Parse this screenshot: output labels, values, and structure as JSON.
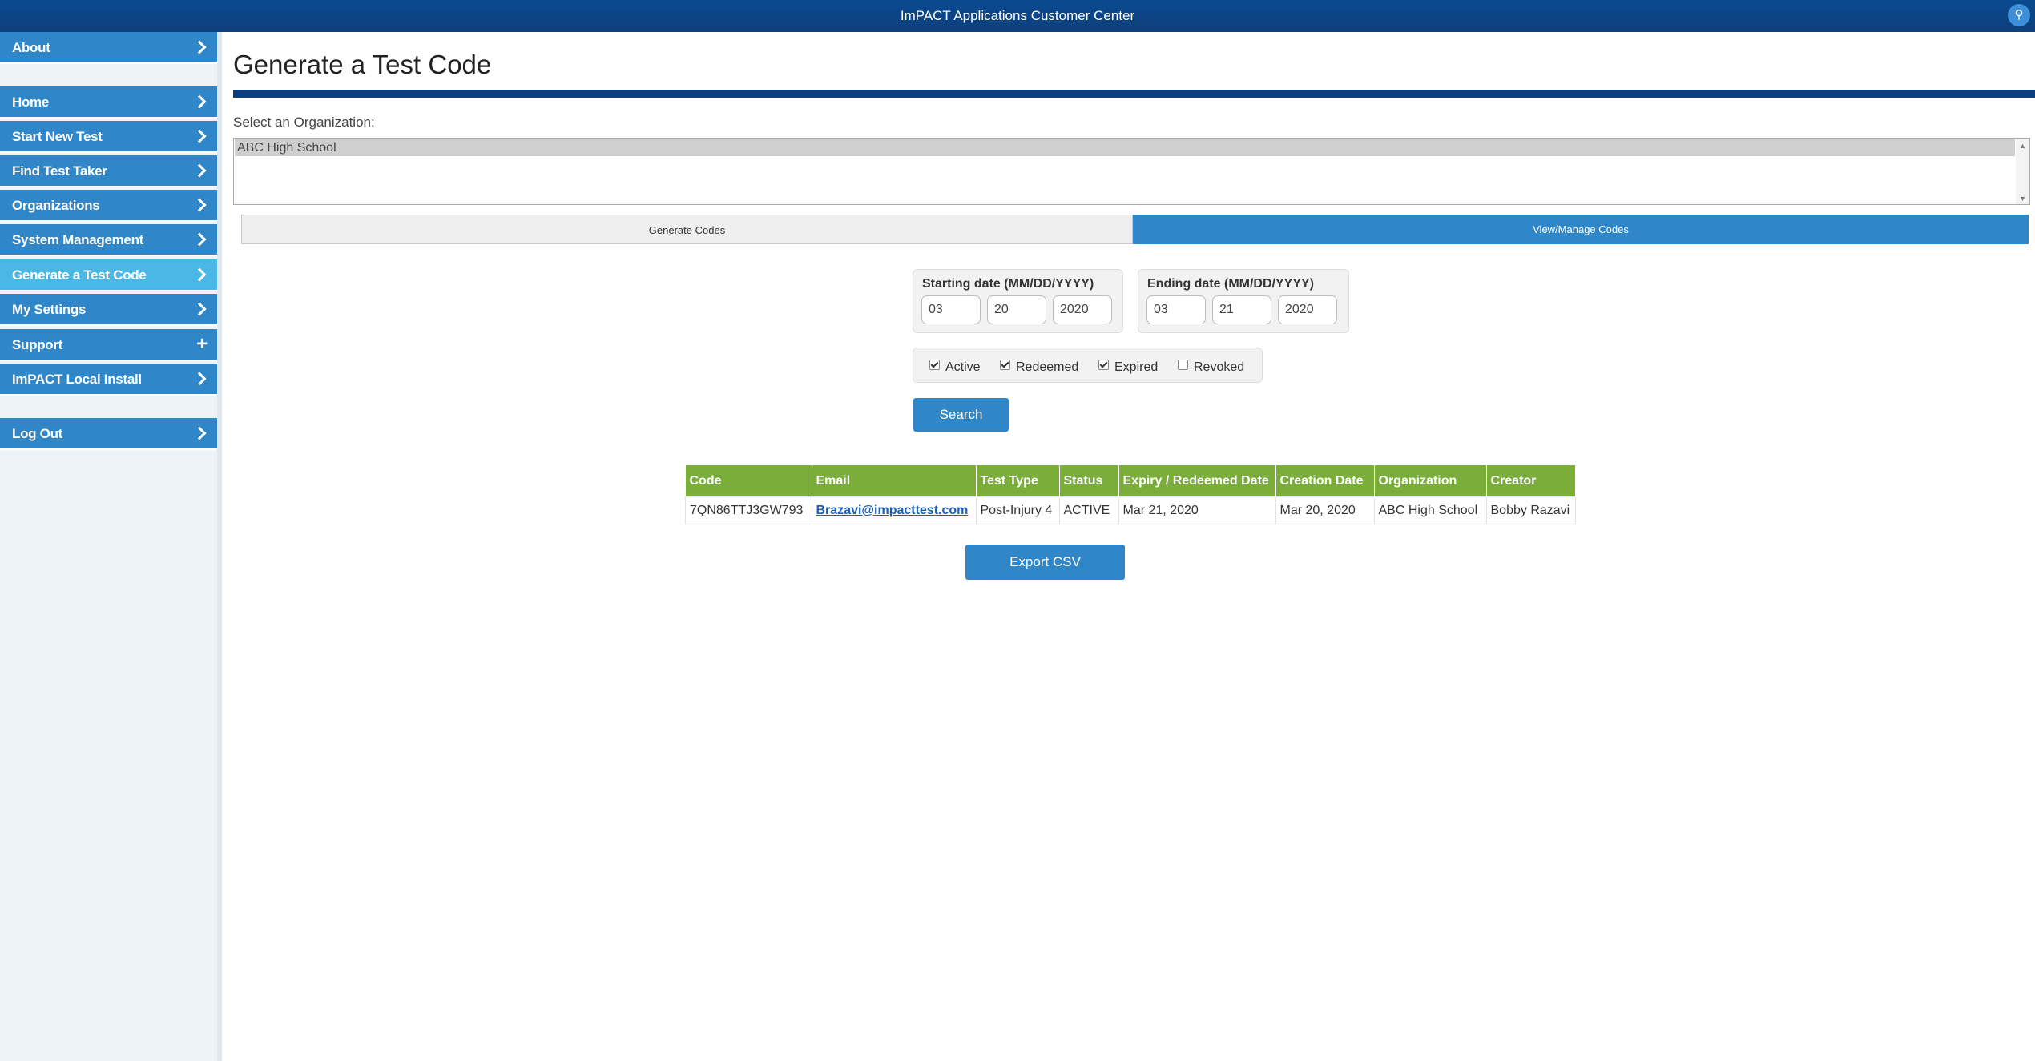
{
  "header": {
    "title": "ImPACT Applications Customer Center",
    "pin_icon": "map-pin-icon"
  },
  "sidebar": {
    "items": [
      {
        "label": "About",
        "icon": "chevron-right-icon"
      },
      {
        "label": "Home",
        "icon": "chevron-right-icon"
      },
      {
        "label": "Start New Test",
        "icon": "chevron-right-icon"
      },
      {
        "label": "Find Test Taker",
        "icon": "chevron-right-icon"
      },
      {
        "label": "Organizations",
        "icon": "chevron-right-icon"
      },
      {
        "label": "System Management",
        "icon": "chevron-right-icon"
      },
      {
        "label": "Generate a Test Code",
        "icon": "chevron-right-icon",
        "active": true
      },
      {
        "label": "My Settings",
        "icon": "chevron-right-icon"
      },
      {
        "label": "Support",
        "icon": "plus-icon"
      },
      {
        "label": "ImPACT Local Install",
        "icon": "chevron-right-icon"
      },
      {
        "label": "Log Out",
        "icon": "chevron-right-icon"
      }
    ],
    "active_color": "#4ab8e6",
    "item_color": "#2f86c8"
  },
  "main": {
    "title": "Generate a Test Code",
    "org_label": "Select an Organization:",
    "org_selected": "ABC High School",
    "tabs": {
      "generate": "Generate Codes",
      "view": "View/Manage Codes"
    },
    "start_date": {
      "label": "Starting date (MM/DD/YYYY)",
      "mm": "03",
      "dd": "20",
      "yyyy": "2020"
    },
    "end_date": {
      "label": "Ending date (MM/DD/YYYY)",
      "mm": "03",
      "dd": "21",
      "yyyy": "2020"
    },
    "filters": [
      {
        "label": "Active",
        "checked": true
      },
      {
        "label": "Redeemed",
        "checked": true
      },
      {
        "label": "Expired",
        "checked": true
      },
      {
        "label": "Revoked",
        "checked": false
      }
    ],
    "search_label": "Search",
    "table": {
      "headers": [
        "Code",
        "Email",
        "Test Type",
        "Status",
        "Expiry / Redeemed Date",
        "Creation Date",
        "Organization",
        "Creator"
      ],
      "rows": [
        [
          "7QN86TTJ3GW793",
          "Brazavi@impacttest.com",
          "Post-Injury 4",
          "ACTIVE",
          "Mar 21, 2020",
          "Mar 20, 2020",
          "ABC High School",
          "Bobby Razavi"
        ]
      ]
    },
    "export_label": "Export CSV",
    "accent_green": "#7aad3a",
    "accent_blue": "#2f86c8"
  }
}
